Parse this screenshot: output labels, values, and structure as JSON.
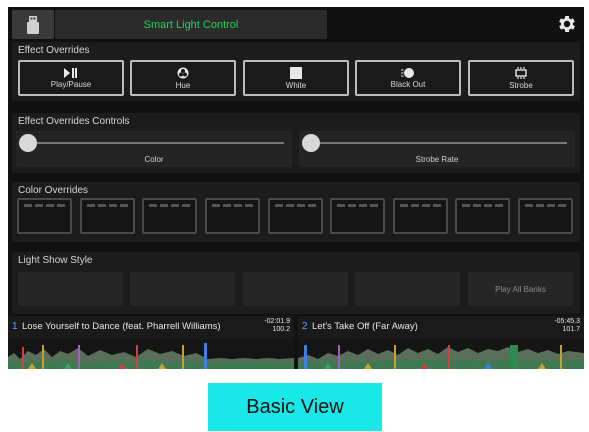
{
  "header": {
    "title": "Smart Light Control",
    "device_icon": "usb-drive-icon",
    "settings_icon": "gear-icon"
  },
  "effects": {
    "title": "Effect Overrides",
    "buttons": [
      {
        "label": "Play/Pause",
        "icon": "play-pause-icon"
      },
      {
        "label": "Hue",
        "icon": "hue-icon"
      },
      {
        "label": "White",
        "icon": "white-square-icon"
      },
      {
        "label": "Black Out",
        "icon": "black-out-icon"
      },
      {
        "label": "Strobe",
        "icon": "strobe-icon"
      }
    ]
  },
  "controls": {
    "title": "Effect Overrides Controls",
    "sliders": [
      {
        "label": "Color",
        "value": 0
      },
      {
        "label": "Strobe Rate",
        "value": 0
      }
    ]
  },
  "colors": {
    "title": "Color Overrides",
    "count": 9
  },
  "light_show": {
    "title": "Light Show Style",
    "banks": [
      "",
      "",
      "",
      "",
      "Play All Banks"
    ]
  },
  "decks": [
    {
      "number": "1",
      "title": "Lose Yourself to Dance (feat. Pharrell Williams)",
      "time": "-02:01.9",
      "bpm": "100.2"
    },
    {
      "number": "2",
      "title": "Let's Take Off (Far Away)",
      "time": "-05:45.3",
      "bpm": "101.7"
    }
  ],
  "caption": "Basic View",
  "colors_palette": {
    "accent_green": "#19d65a",
    "deck_blue": "#5aa2ff",
    "caption_bg": "#18e8e8"
  }
}
